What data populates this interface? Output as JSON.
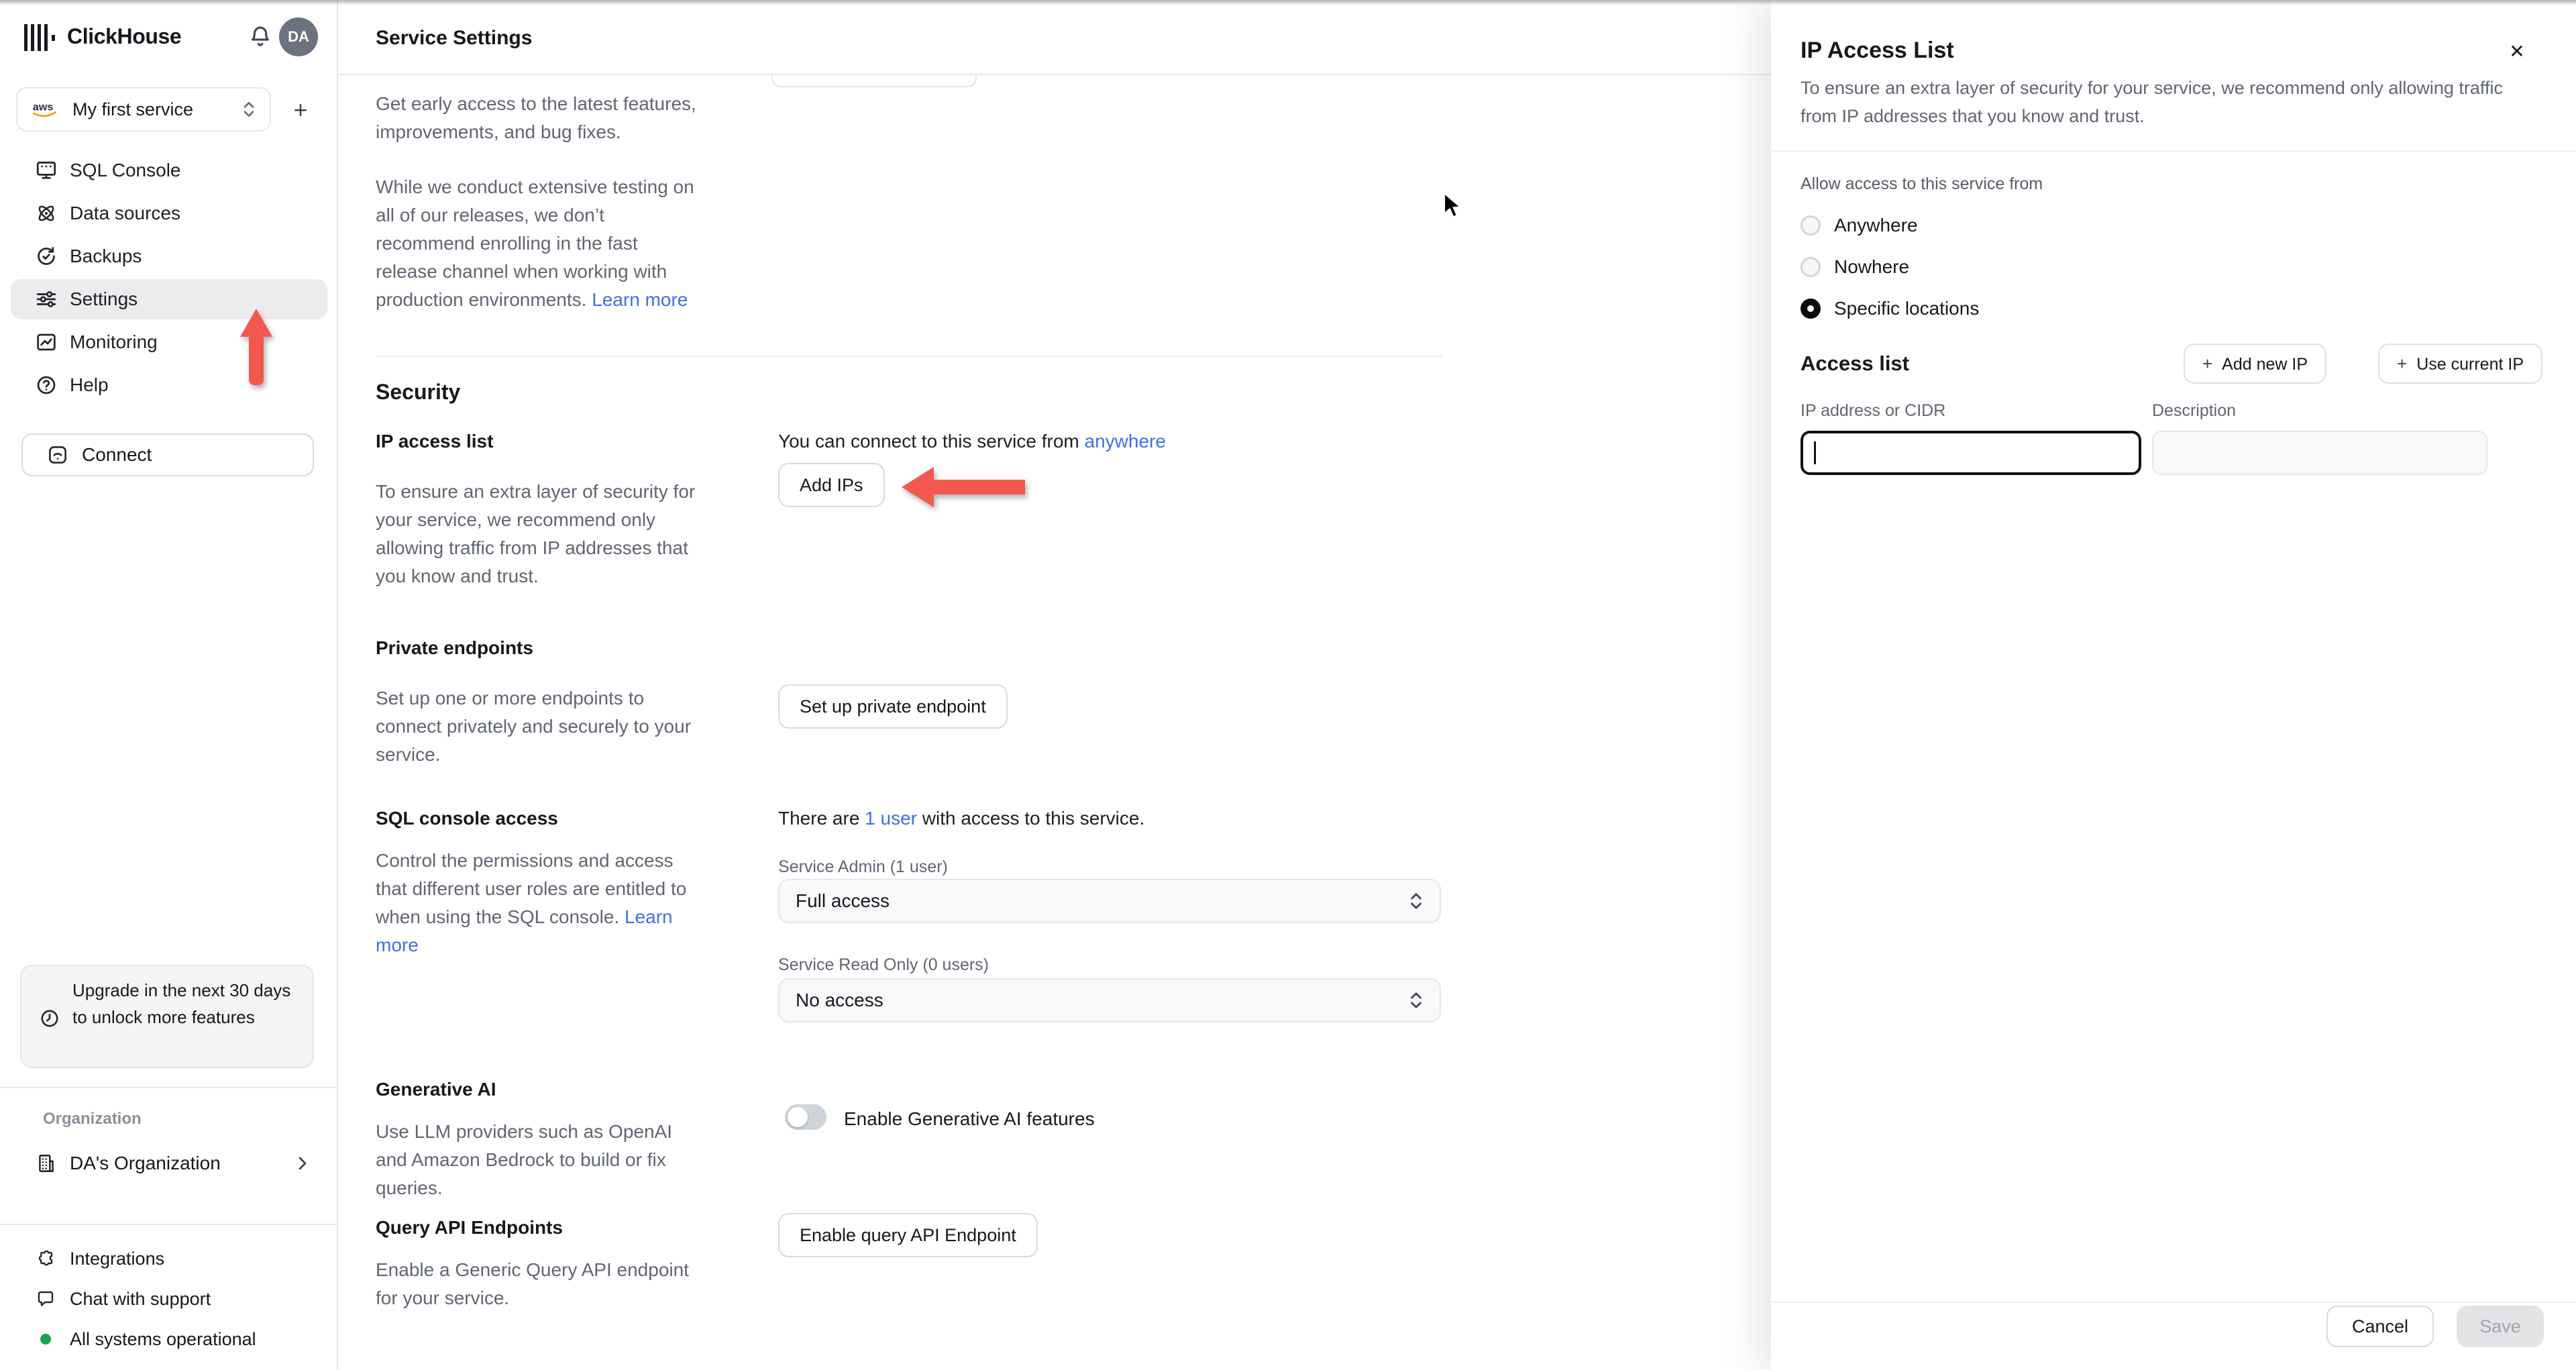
{
  "icons": {
    "plus": "+",
    "close": "✕"
  },
  "topbar": {
    "brand": "ClickHouse",
    "avatar_initials": "DA"
  },
  "sidebar": {
    "service": {
      "name": "My first service"
    },
    "nav": [
      {
        "label": "SQL Console"
      },
      {
        "label": "Data sources"
      },
      {
        "label": "Backups"
      },
      {
        "label": "Settings"
      },
      {
        "label": "Monitoring"
      },
      {
        "label": "Help"
      }
    ],
    "connect_label": "Connect",
    "upgrade_notice": "Upgrade in the next 30 days to unlock more features",
    "organization_label": "Organization",
    "organization_name": "DA's Organization",
    "integrations_label": "Integrations",
    "chat_label": "Chat with support",
    "status_label": "All systems operational",
    "status_color": "#16a34a"
  },
  "main": {
    "title": "Service Settings",
    "fast_release": {
      "p1": "Get early access to the latest features, improvements, and bug fixes.",
      "p2": "While we conduct extensive testing on all of our releases, we don’t recommend enrolling in the fast release channel when working with production environments.",
      "learn_more": "Learn more"
    },
    "security_heading": "Security",
    "ip_access": {
      "title": "IP access list",
      "desc": "To ensure an extra layer of security for your service, we recommend only allowing traffic from IP addresses that you know and trust.",
      "status_prefix": "You can connect to this service from ",
      "status_link": "anywhere",
      "button": "Add IPs"
    },
    "private_endpoints": {
      "title": "Private endpoints",
      "desc": "Set up one or more endpoints to connect privately and securely to your service.",
      "button": "Set up private endpoint"
    },
    "sql_console": {
      "title": "SQL console access",
      "desc": "Control the permissions and access that different user roles are entitled to when using the SQL console. ",
      "learn_more": "Learn more",
      "users_prefix": "There are ",
      "users_link": "1 user",
      "users_suffix": " with access to this service.",
      "admin_label": "Service Admin (1 user)",
      "admin_value": "Full access",
      "readonly_label": "Service Read Only (0 users)",
      "readonly_value": "No access"
    },
    "generative_ai": {
      "title": "Generative AI",
      "desc": "Use LLM providers such as OpenAI and Amazon Bedrock to build or fix queries.",
      "toggle_label": "Enable Generative AI features",
      "toggle_state": "off"
    },
    "query_api": {
      "title": "Query API Endpoints",
      "desc": "Enable a Generic Query API endpoint for your service.",
      "button": "Enable query API Endpoint"
    }
  },
  "panel": {
    "title": "IP Access List",
    "desc": "To ensure an extra layer of security for your service, we recommend only allowing traffic from IP addresses that you know and trust.",
    "allow_label": "Allow access to this service from",
    "radios": [
      {
        "label": "Anywhere",
        "selected": false
      },
      {
        "label": "Nowhere",
        "selected": false
      },
      {
        "label": "Specific locations",
        "selected": true
      }
    ],
    "access_list_heading": "Access list",
    "add_new_ip_label": "Add new IP",
    "use_current_ip_label": "Use current IP",
    "ip_field_label": "IP address or CIDR",
    "desc_field_label": "Description",
    "ip_value": "",
    "desc_value": "",
    "cancel_label": "Cancel",
    "save_label": "Save"
  }
}
